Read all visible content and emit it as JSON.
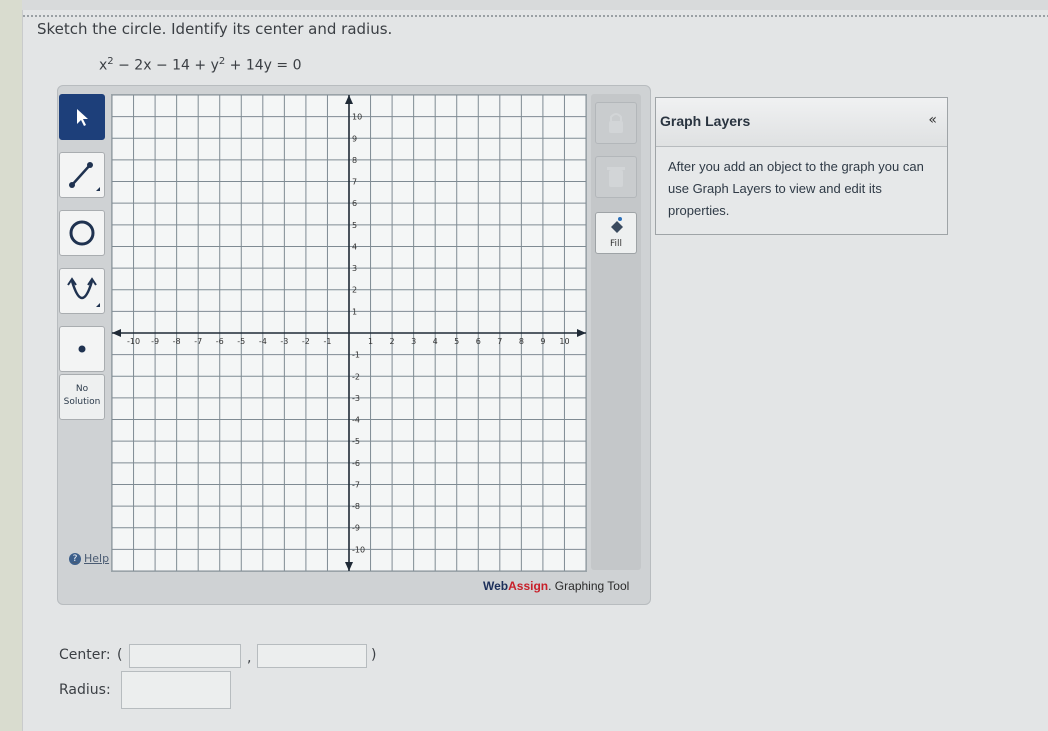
{
  "question": {
    "prompt": "Sketch the circle. Identify its center and radius.",
    "equation_parts": {
      "x_squared": "x",
      "exp": "2",
      "middle": " − 2x − 14 + y",
      "exp2": "2",
      "end": " + 14y = 0"
    }
  },
  "toolbar": {
    "no_solution_label": "No Solution",
    "help_label": "Help",
    "help_icon": "?"
  },
  "graph": {
    "x_ticks": [
      "-10",
      "-9",
      "-8",
      "-7",
      "-6",
      "-5",
      "-4",
      "-3",
      "-2",
      "-1",
      "1",
      "2",
      "3",
      "4",
      "5",
      "6",
      "7",
      "8",
      "9",
      "10"
    ],
    "y_ticks_pos": [
      "10",
      "9",
      "8",
      "7",
      "6",
      "5",
      "4",
      "3",
      "2",
      "1"
    ],
    "y_ticks_neg": [
      "-1",
      "-2",
      "-3",
      "-4",
      "-5",
      "-6",
      "-7",
      "-8",
      "-9",
      "-10"
    ],
    "xlim": [
      -11,
      11
    ],
    "ylim": [
      -11,
      11
    ]
  },
  "right_panel": {
    "fill_label": "Fill"
  },
  "brand": {
    "web": "Web",
    "assign": "Assign",
    "rest": ". Graphing Tool"
  },
  "layers": {
    "title": "Graph Layers",
    "collapse": "«",
    "description": "After you add an object to the graph you can use Graph Layers to view and edit its properties."
  },
  "answers": {
    "center_label": "Center:",
    "open_paren": "(",
    "comma": ",",
    "close_paren": ")",
    "radius_label": "Radius:",
    "center_x_value": "",
    "center_y_value": "",
    "radius_value": ""
  },
  "colors": {
    "toolbar_active": "#1d3f7a",
    "brand_blue": "#1c2f5a",
    "brand_red": "#c8202a"
  }
}
